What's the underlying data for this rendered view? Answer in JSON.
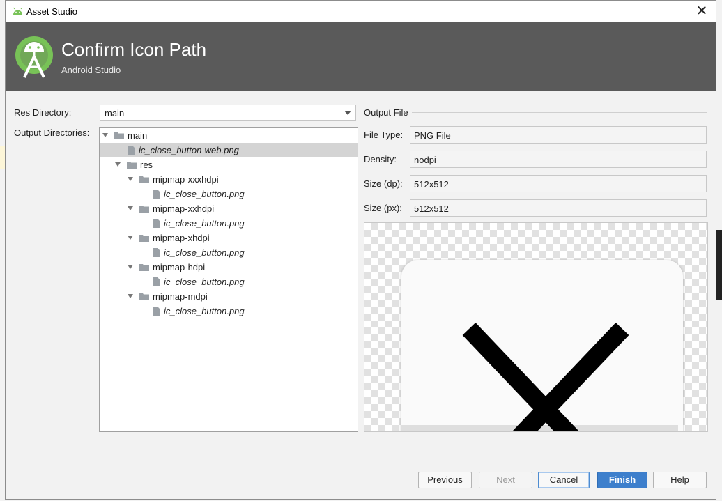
{
  "window": {
    "title": "Asset Studio",
    "close_glyph": "✕"
  },
  "banner": {
    "heading": "Confirm Icon Path",
    "subtitle": "Android Studio"
  },
  "labels": {
    "res_directory": "Res Directory:",
    "output_directories": "Output Directories:",
    "output_file": "Output File"
  },
  "res_directory_value": "main",
  "tree": [
    {
      "label": "main",
      "kind": "folder",
      "depth": 0,
      "expanded": true,
      "italic": false
    },
    {
      "label": "ic_close_button-web.png",
      "kind": "file",
      "depth": 1,
      "selected": true,
      "italic": true
    },
    {
      "label": "res",
      "kind": "folder",
      "depth": 1,
      "expanded": true,
      "italic": false
    },
    {
      "label": "mipmap-xxxhdpi",
      "kind": "folder",
      "depth": 2,
      "expanded": true,
      "italic": false
    },
    {
      "label": "ic_close_button.png",
      "kind": "file",
      "depth": 3,
      "italic": true
    },
    {
      "label": "mipmap-xxhdpi",
      "kind": "folder",
      "depth": 2,
      "expanded": true,
      "italic": false
    },
    {
      "label": "ic_close_button.png",
      "kind": "file",
      "depth": 3,
      "italic": true
    },
    {
      "label": "mipmap-xhdpi",
      "kind": "folder",
      "depth": 2,
      "expanded": true,
      "italic": false
    },
    {
      "label": "ic_close_button.png",
      "kind": "file",
      "depth": 3,
      "italic": true
    },
    {
      "label": "mipmap-hdpi",
      "kind": "folder",
      "depth": 2,
      "expanded": true,
      "italic": false
    },
    {
      "label": "ic_close_button.png",
      "kind": "file",
      "depth": 3,
      "italic": true
    },
    {
      "label": "mipmap-mdpi",
      "kind": "folder",
      "depth": 2,
      "expanded": true,
      "italic": false
    },
    {
      "label": "ic_close_button.png",
      "kind": "file",
      "depth": 3,
      "italic": true
    }
  ],
  "output_file": {
    "file_type": {
      "label": "File Type:",
      "value": "PNG File"
    },
    "density": {
      "label": "Density:",
      "value": "nodpi"
    },
    "size_dp": {
      "label": "Size (dp):",
      "value": "512x512"
    },
    "size_px": {
      "label": "Size (px):",
      "value": "512x512"
    }
  },
  "buttons": {
    "previous": {
      "mnemonic": "P",
      "rest": "revious"
    },
    "next": "Next",
    "cancel": {
      "mnemonic": "C",
      "rest": "ancel"
    },
    "finish": {
      "mnemonic": "F",
      "rest": "inish"
    },
    "help": "Help"
  },
  "colors": {
    "banner": "#5a5a5a",
    "primary_button": "#3d7fcc",
    "android_green": "#78c257",
    "selection": "#d4d4d4"
  },
  "icons": {
    "app": "android-head-icon",
    "logo": "android-studio-logo-icon",
    "folder": "folder-icon",
    "file": "file-icon",
    "expand": "triangle-down-icon"
  }
}
